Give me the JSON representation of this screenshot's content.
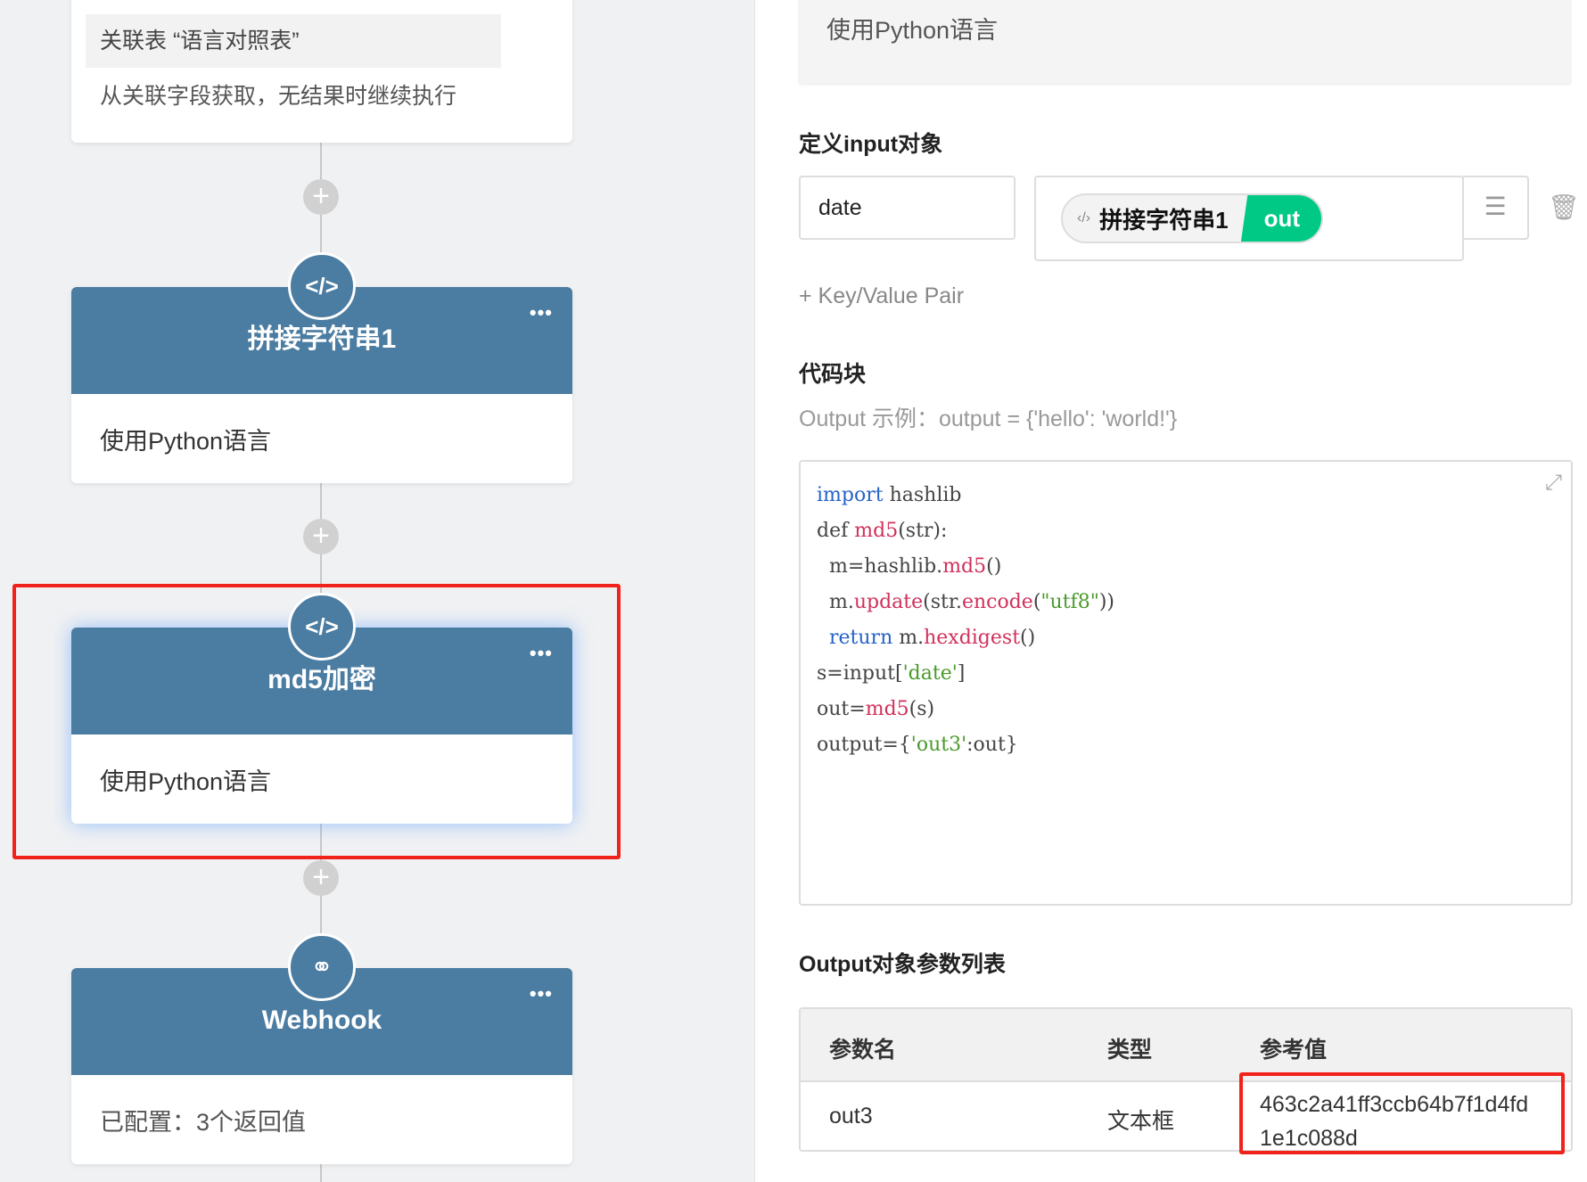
{
  "flow": {
    "top_card": {
      "relation": "关联表 “语言对照表”",
      "desc": "从关联字段获取，无结果时继续执行"
    },
    "nodes": [
      {
        "title": "拼接字符串1",
        "desc": "使用Python语言",
        "icon": "code-icon"
      },
      {
        "title": "md5加密",
        "desc": "使用Python语言",
        "icon": "code-icon",
        "selected": true
      },
      {
        "title": "Webhook",
        "desc": "已配置：3个返回值",
        "icon": "webhook-icon"
      }
    ],
    "more": "•••",
    "plus": "+"
  },
  "panel": {
    "description": "使用Python语言",
    "input_heading": "定义input对象",
    "input_key": "date",
    "input_value_node": "拼接字符串1",
    "input_value_field": "out",
    "add_pair": "+ Key/Value Pair",
    "code_heading": "代码块",
    "code_hint": "Output 示例：output = {'hello': 'world!'}",
    "output_heading": "Output对象参数列表",
    "table": {
      "headers": [
        "参数名",
        "类型",
        "参考值"
      ],
      "rows": [
        {
          "name": "out3",
          "type": "文本框",
          "value": "463c2a41ff3ccb64b7f1d4fd1e1c088d"
        }
      ]
    },
    "accent": "#00c985"
  }
}
